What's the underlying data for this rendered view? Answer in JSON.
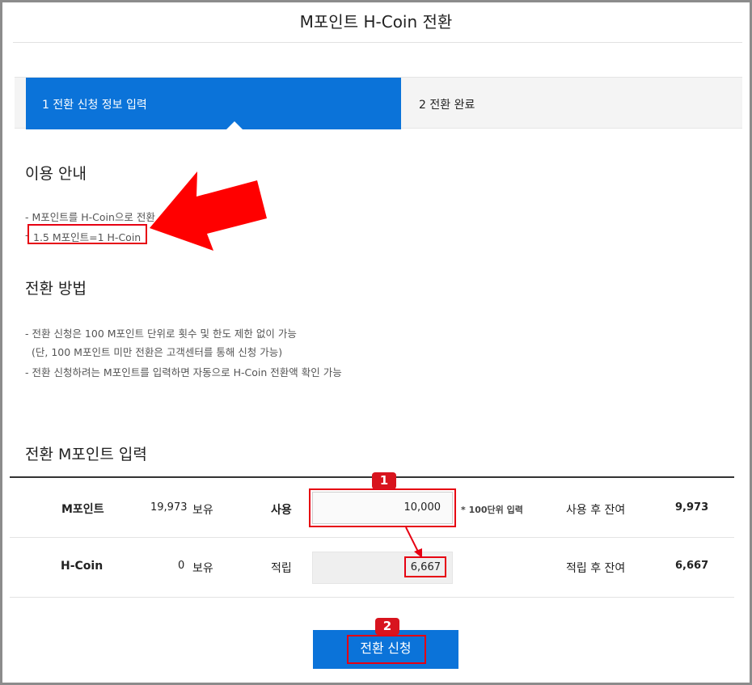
{
  "page": {
    "title": "M포인트 H-Coin 전환"
  },
  "steps": [
    {
      "label": "1 전환 신청 정보 입력",
      "active": true
    },
    {
      "label": "2 전환 완료",
      "active": false
    }
  ],
  "guide": {
    "heading": "이용 안내",
    "lines": [
      "- M포인트를 H-Coin으로 전환",
      "1.5 M포인트=1 H-Coin"
    ]
  },
  "method": {
    "heading": "전환 방법",
    "lines": [
      "- 전환 신청은 100 M포인트 단위로 횟수 및 한도 제한 없이 가능",
      "(단, 100 M포인트 미만 전환은 고객센터를 통해 신청 가능)",
      "- 전환 신청하려는 M포인트를 입력하면 자동으로 H-Coin 전환액 확인 가능"
    ]
  },
  "input_section": {
    "heading": "전환 M포인트 입력",
    "rows": [
      {
        "name": "M포인트",
        "balance": "19,973",
        "balance_suffix": "보유",
        "action": "사용",
        "value": "10,000",
        "note": "* 100단위 입력",
        "after_label": "사용 후 잔여",
        "after_value": "9,973"
      },
      {
        "name": "H-Coin",
        "balance": "0",
        "balance_suffix": "보유",
        "action": "적립",
        "value": "6,667",
        "after_label": "적립 후 잔여",
        "after_value": "6,667"
      }
    ]
  },
  "submit_label": "전환 신청",
  "annotations": {
    "badge_1": "1",
    "badge_2": "2",
    "accent": "#e60012"
  },
  "colors": {
    "primary": "#0b73d9"
  }
}
